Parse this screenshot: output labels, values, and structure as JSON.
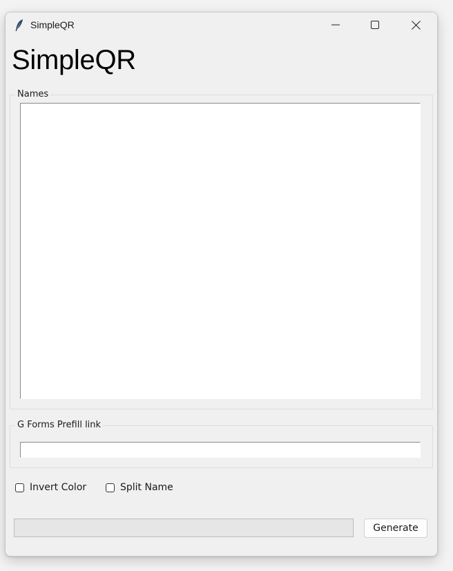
{
  "window": {
    "title": "SimpleQR",
    "controls": {
      "minimize_icon": "minimize-icon",
      "maximize_icon": "maximize-icon",
      "close_icon": "close-icon"
    }
  },
  "app": {
    "heading": "SimpleQR"
  },
  "names_group": {
    "legend": "Names",
    "text_value": ""
  },
  "link_group": {
    "legend": "G Forms Prefill link",
    "input_value": ""
  },
  "options": {
    "invert_color": {
      "label": "Invert Color",
      "checked": false
    },
    "split_name": {
      "label": "Split Name",
      "checked": false
    }
  },
  "progress": {
    "value": 0
  },
  "actions": {
    "generate_label": "Generate"
  },
  "colors": {
    "window_bg": "#f0f0f0",
    "progress_fill": "#06b025"
  }
}
